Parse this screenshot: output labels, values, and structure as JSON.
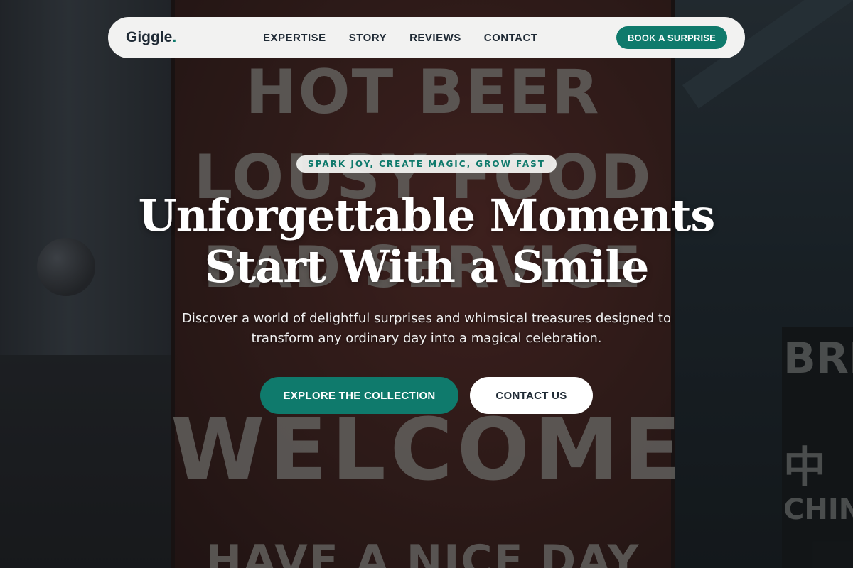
{
  "brand": {
    "name": "Giggle",
    "dot": ".",
    "accent_color": "#0f7a6c",
    "text_color": "#1f2a35"
  },
  "nav": {
    "links": [
      {
        "label": "EXPERTISE"
      },
      {
        "label": "STORY"
      },
      {
        "label": "REVIEWS"
      },
      {
        "label": "CONTACT"
      }
    ],
    "cta_label": "BOOK A SURPRISE"
  },
  "hero": {
    "tagline": "SPARK JOY, CREATE MAGIC, GROW FAST",
    "headline_line1": "Unforgettable Moments",
    "headline_line2": "Start With a Smile",
    "subtext": "Discover a world of delightful surprises and whimsical treasures designed to transform any ordinary day into a magical celebration.",
    "primary_button": "EXPLORE THE COLLECTION",
    "secondary_button": "CONTACT US"
  },
  "background_photo": {
    "sign_lines": [
      "HOT BEER",
      "LOUSY FOOD",
      "BAD SERVICE",
      "WELCOME",
      "HAVE A NICE DAY"
    ],
    "right_sign_lines": [
      "BRE",
      "中",
      "CHINE"
    ]
  }
}
